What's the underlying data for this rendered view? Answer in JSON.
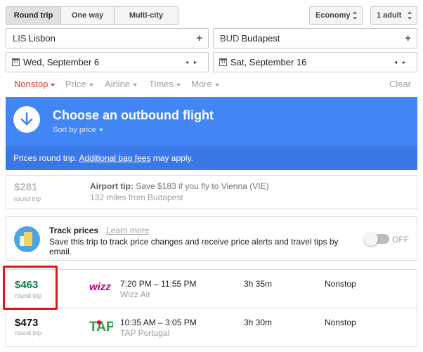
{
  "trip_types": [
    "Round trip",
    "One way",
    "Multi-city"
  ],
  "cabin_class": "Economy",
  "passengers": "1 adult",
  "origin": {
    "code": "LIS",
    "city": "Lisbon"
  },
  "destination": {
    "code": "BUD",
    "city": "Budapest"
  },
  "plus_symbol": "+",
  "calendar_day": "31",
  "depart_date": "Wed, September 6",
  "return_date": "Sat, September 16",
  "date_arrows": "◂▸",
  "filters": {
    "nonstop": "Nonstop",
    "price": "Price",
    "airline": "Airline",
    "times": "Times",
    "more": "More",
    "clear": "Clear"
  },
  "banner": {
    "title": "Choose an outbound flight",
    "sort": "Sort by price",
    "note_prefix": "Prices round trip.",
    "note_link": "Additional bag fees",
    "note_suffix": "may apply."
  },
  "tip": {
    "price": "$281",
    "sub": "round trip",
    "label": "Airport tip:",
    "text": "Save $183 if you fly to Vienna (VIE)",
    "distance": "132 miles from Budapest"
  },
  "track": {
    "title": "Track prices",
    "learn": "Learn more",
    "description": "Save this trip to track price changes and receive price alerts and travel tips by email.",
    "state": "OFF"
  },
  "flights": [
    {
      "price": "$463",
      "sub": "round trip",
      "time": "7:20 PM – 11:55 PM",
      "airline": "Wizz Air",
      "logo_text": "wizz",
      "duration": "3h 35m",
      "stops": "Nonstop"
    },
    {
      "price": "$473",
      "sub": "round trip",
      "time": "10:35 AM – 3:05 PM",
      "airline": "TAP Portugal",
      "logo_text": "TAP",
      "duration": "3h 30m",
      "stops": "Nonstop"
    }
  ],
  "colors": {
    "accent": "#4285f4",
    "filter_active": "#d23f31",
    "best_price": "#0b8043",
    "highlight": "#e0141b"
  }
}
